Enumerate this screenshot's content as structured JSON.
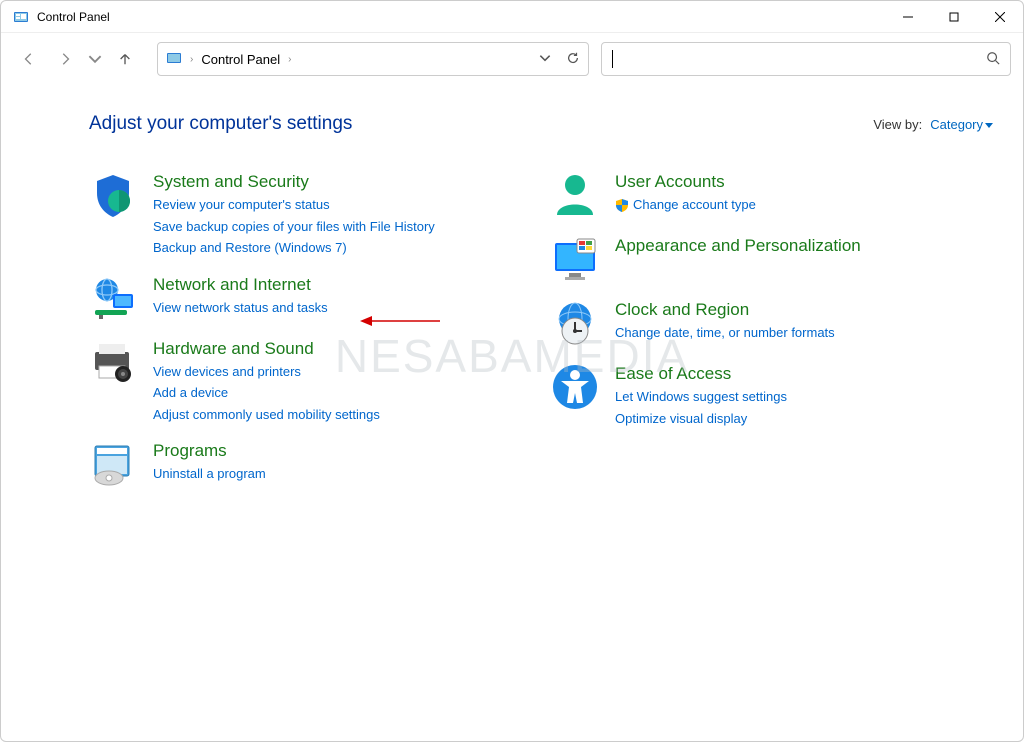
{
  "window": {
    "title": "Control Panel"
  },
  "address": {
    "crumb": "Control Panel"
  },
  "search": {
    "placeholder": ""
  },
  "heading": "Adjust your computer's settings",
  "viewby": {
    "label": "View by:",
    "value": "Category"
  },
  "left": [
    {
      "title": "System and Security",
      "links": [
        "Review your computer's status",
        "Save backup copies of your files with File History",
        "Backup and Restore (Windows 7)"
      ]
    },
    {
      "title": "Network and Internet",
      "links": [
        "View network status and tasks"
      ]
    },
    {
      "title": "Hardware and Sound",
      "links": [
        "View devices and printers",
        "Add a device",
        "Adjust commonly used mobility settings"
      ]
    },
    {
      "title": "Programs",
      "links": [
        "Uninstall a program"
      ]
    }
  ],
  "right": [
    {
      "title": "User Accounts",
      "links": [
        "Change account type"
      ],
      "shield_on_first": true
    },
    {
      "title": "Appearance and Personalization",
      "links": []
    },
    {
      "title": "Clock and Region",
      "links": [
        "Change date, time, or number formats"
      ]
    },
    {
      "title": "Ease of Access",
      "links": [
        "Let Windows suggest settings",
        "Optimize visual display"
      ]
    }
  ],
  "watermark": "NESABAMEDIA"
}
